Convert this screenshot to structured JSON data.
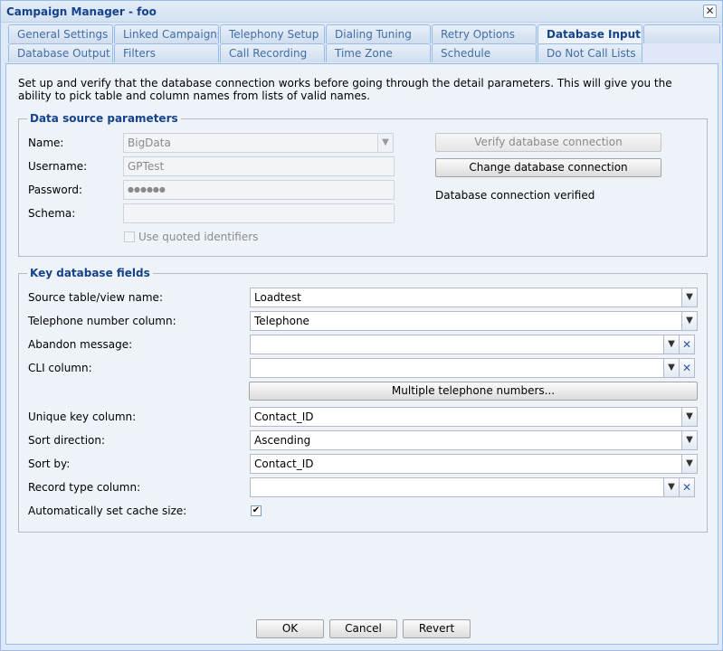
{
  "window": {
    "title": "Campaign Manager - foo",
    "close_label": "✕"
  },
  "tabs": {
    "row1": [
      "General Settings",
      "Linked Campaigns",
      "Telephony Setup",
      "Dialing Tuning",
      "Retry Options",
      "Database Input"
    ],
    "row2": [
      "Database Output",
      "Filters",
      "Call Recording",
      "Time Zone",
      "Schedule",
      "Do Not Call Lists"
    ],
    "active": "Database Input"
  },
  "description": "Set up and verify that the database connection works before going through the detail parameters. This will give you the ability to pick table and column names from lists of valid names.",
  "datasource": {
    "legend": "Data source parameters",
    "name_label": "Name:",
    "name_value": "BigData",
    "username_label": "Username:",
    "username_value": "GPTest",
    "password_label": "Password:",
    "password_value": "●●●●●●",
    "schema_label": "Schema:",
    "schema_value": "",
    "quoted_label": "Use quoted identifiers",
    "verify_button": "Verify database connection",
    "change_button": "Change database connection",
    "status": "Database connection verified"
  },
  "keyfields": {
    "legend": "Key database fields",
    "source_label": "Source table/view name:",
    "source_value": "Loadtest",
    "telephone_label": "Telephone number column:",
    "telephone_value": "Telephone",
    "abandon_label": "Abandon message:",
    "abandon_value": "",
    "cli_label": "CLI column:",
    "cli_value": "",
    "multiple_button": "Multiple telephone numbers...",
    "unique_label": "Unique key column:",
    "unique_value": "Contact_ID",
    "sortdir_label": "Sort direction:",
    "sortdir_value": "Ascending",
    "sortby_label": "Sort by:",
    "sortby_value": "Contact_ID",
    "recordtype_label": "Record type column:",
    "recordtype_value": "",
    "cache_label": "Automatically set cache size:",
    "cache_checked": true
  },
  "footer": {
    "ok": "OK",
    "cancel": "Cancel",
    "revert": "Revert"
  },
  "icons": {
    "dropdown": "chevron-down-icon",
    "clear": "clear-x-icon",
    "check": "checkmark-icon"
  },
  "colors": {
    "title": "#15428b",
    "border": "#99bbe8",
    "panel": "#eef3fa"
  }
}
